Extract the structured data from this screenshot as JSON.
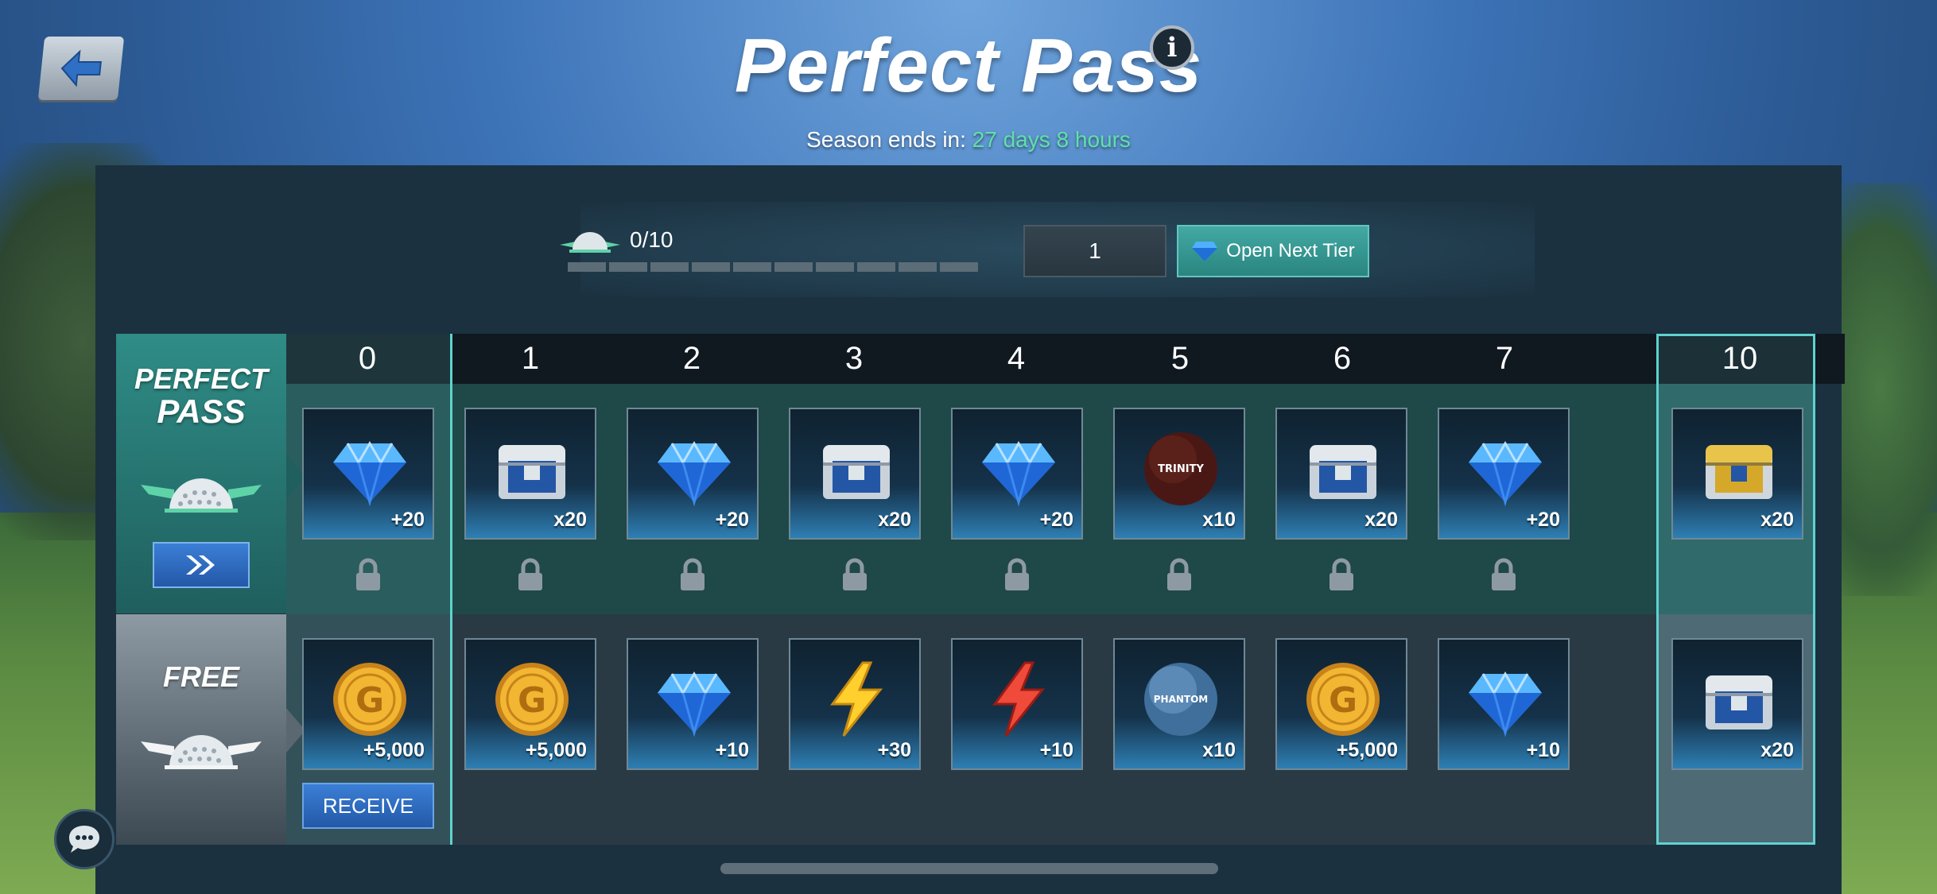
{
  "header": {
    "title": "Perfect Pass",
    "season_label": "Season ends in:",
    "season_time": "27 days 8 hours"
  },
  "progress": {
    "count": "0/10",
    "value": 0,
    "max": 10,
    "tier_input": "1",
    "open_next_tier_label": "Open Next Tier"
  },
  "rows": {
    "perfect_pass_label_1": "PERFECT",
    "perfect_pass_label_2": "PASS",
    "free_label": "FREE",
    "receive_label": "RECEIVE"
  },
  "tiers": [
    "0",
    "1",
    "2",
    "3",
    "4",
    "5",
    "6",
    "7",
    "10"
  ],
  "perfect_rewards": [
    {
      "icon": "gem-icon",
      "qty": "+20",
      "locked": true
    },
    {
      "icon": "chest-icon",
      "qty": "x20",
      "locked": true
    },
    {
      "icon": "gem-icon",
      "qty": "+20",
      "locked": true
    },
    {
      "icon": "chest-icon",
      "qty": "x20",
      "locked": true
    },
    {
      "icon": "gem-icon",
      "qty": "+20",
      "locked": true
    },
    {
      "icon": "golf-ball-dark-icon",
      "qty": "x10",
      "locked": true
    },
    {
      "icon": "chest-icon",
      "qty": "x20",
      "locked": true
    },
    {
      "icon": "gem-icon",
      "qty": "+20",
      "locked": true
    },
    {
      "icon": "gold-chest-icon",
      "qty": "x20",
      "locked": false
    }
  ],
  "free_rewards": [
    {
      "icon": "gold-coin-icon",
      "qty": "+5,000"
    },
    {
      "icon": "gold-coin-icon",
      "qty": "+5,000"
    },
    {
      "icon": "gem-icon",
      "qty": "+10"
    },
    {
      "icon": "yellow-bolt-icon",
      "qty": "+30"
    },
    {
      "icon": "red-bolt-icon",
      "qty": "+10"
    },
    {
      "icon": "golf-ball-blue-icon",
      "qty": "x10"
    },
    {
      "icon": "gold-coin-icon",
      "qty": "+5,000"
    },
    {
      "icon": "gem-icon",
      "qty": "+10"
    },
    {
      "icon": "chest-icon",
      "qty": "x20"
    }
  ],
  "colors": {
    "accent_teal": "#5fd3d0",
    "season_time": "#5fe0a8",
    "button_blue": "#2f6fc4"
  }
}
